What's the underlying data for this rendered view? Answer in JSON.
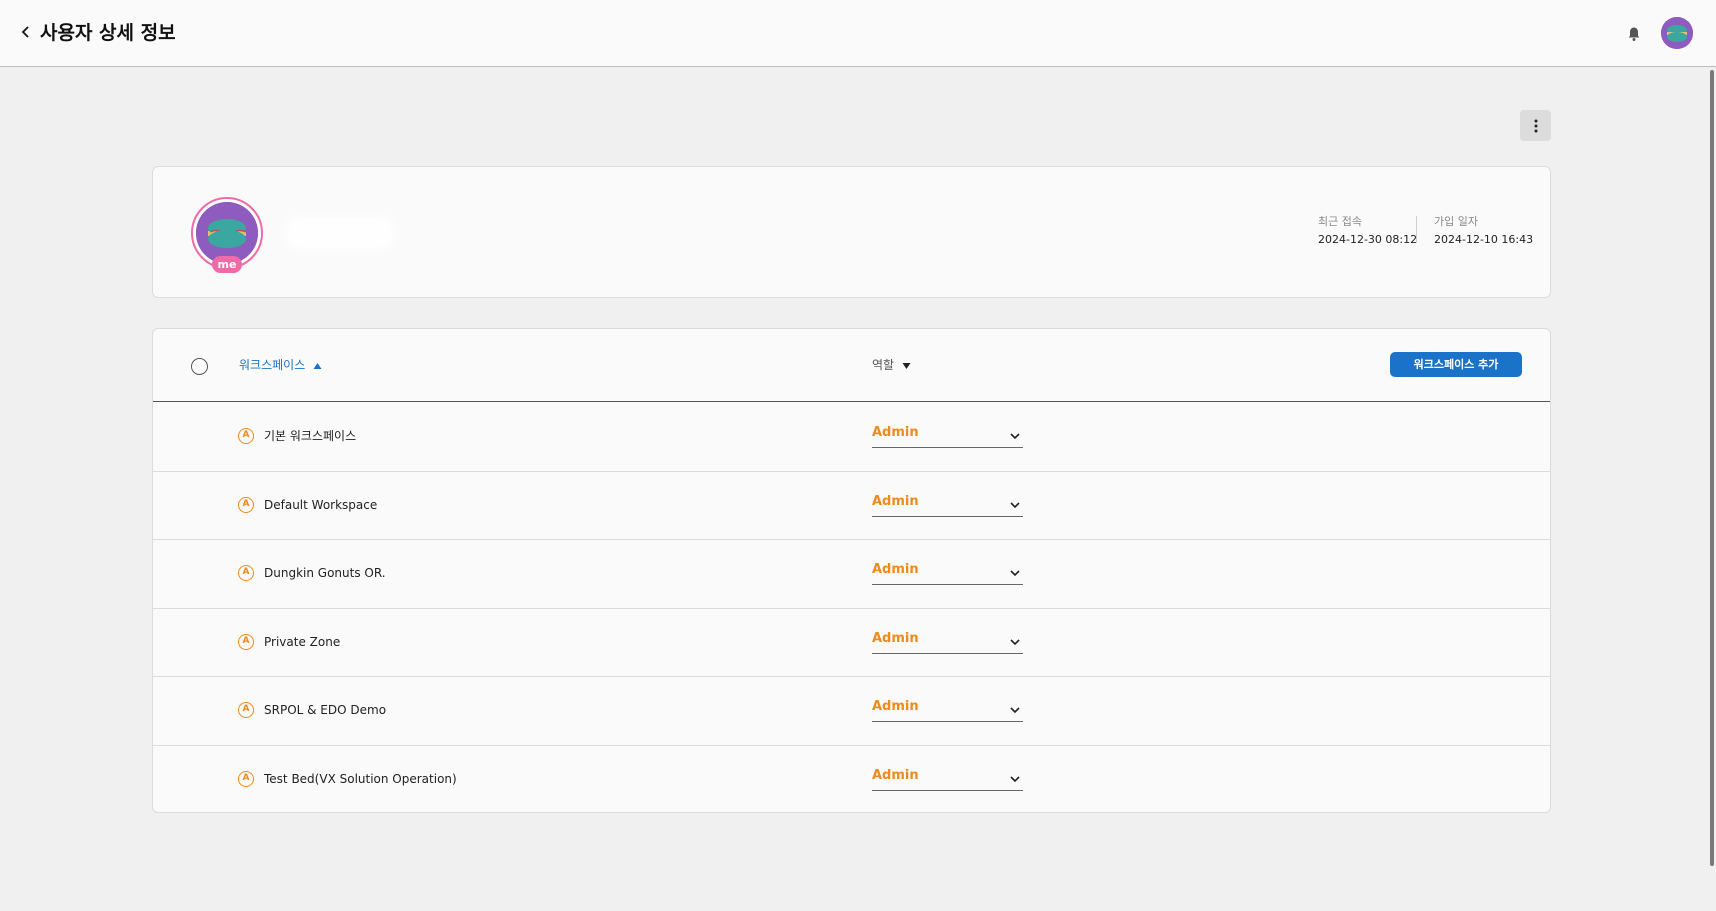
{
  "header": {
    "title": "사용자 상세 정보",
    "back_icon": "chevron-left-icon",
    "bell_icon": "bell-icon"
  },
  "profile": {
    "badge": "me",
    "last_access_label": "최근 접속",
    "last_access_value": "2024-12-30 08:12",
    "joined_label": "가입 일자",
    "joined_value": "2024-12-10 16:43"
  },
  "workspaces": {
    "column_workspace": "워크스페이스",
    "column_role": "역할",
    "add_button": "워크스페이스 추가",
    "rows": [
      {
        "icon": "A",
        "name": "기본 워크스페이스",
        "role": "Admin"
      },
      {
        "icon": "A",
        "name": "Default Workspace",
        "role": "Admin"
      },
      {
        "icon": "A",
        "name": "Dungkin Gonuts OR.",
        "role": "Admin"
      },
      {
        "icon": "A",
        "name": "Private Zone",
        "role": "Admin"
      },
      {
        "icon": "A",
        "name": "SRPOL & EDO Demo",
        "role": "Admin"
      },
      {
        "icon": "A",
        "name": "Test Bed(VX Solution Operation)",
        "role": "Admin"
      }
    ]
  },
  "colors": {
    "accent_blue": "#1a73c8",
    "role_orange": "#f08a1d",
    "me_pink": "#f06aa7",
    "avatar_purple": "#8e5bbf"
  }
}
